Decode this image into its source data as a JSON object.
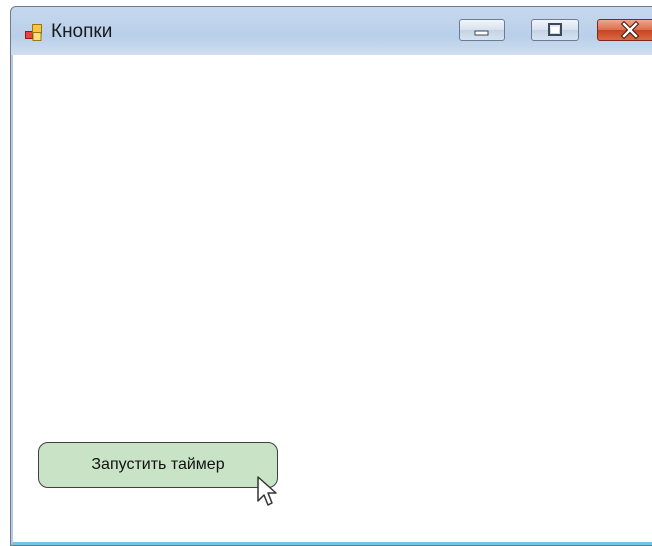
{
  "window": {
    "title": "Кнопки",
    "icon": "app-window-icon",
    "controls": {
      "minimize_icon": "minimize-icon",
      "maximize_icon": "maximize-icon",
      "close_icon": "close-icon"
    }
  },
  "main": {
    "button_label": "Запустить таймер",
    "button_color": "#c9e3c6"
  },
  "cursor": "mouse-pointer-icon"
}
